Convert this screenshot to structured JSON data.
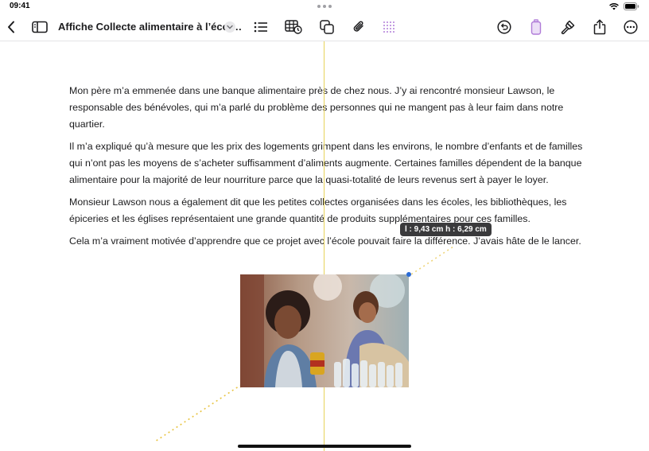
{
  "status_bar": {
    "time": "09:41"
  },
  "toolbar": {
    "title": "Affiche Collecte alimentaire à l’écol…",
    "icons": [
      "back-chevron-icon",
      "sidebar-icon",
      "title-chevron-down-icon",
      "list-icon",
      "table-icon",
      "shapes-icon",
      "attachment-icon",
      "grid-icon",
      "undo-icon",
      "pen-icon",
      "brush-icon",
      "share-icon",
      "more-icon"
    ],
    "accent_color": "#b07cd8"
  },
  "document": {
    "paragraphs": [
      "Mon père m’a emmenée dans une banque alimentaire près de chez nous. J’y ai rencontré monsieur Lawson, le responsable des bénévoles, qui m’a parlé du problème des personnes qui ne mangent pas à leur faim dans notre quartier.",
      "Il m’a expliqué qu’à mesure que les prix des logements grimpent dans les environs, le nombre d’enfants et de familles qui n’ont pas les moyens de s’acheter suffisamment d’aliments augmente. Certaines familles dépendent de la banque alimentaire pour la majorité de leur nourriture parce que la quasi-totalité de leurs revenus sert à payer le loyer.",
      "Monsieur Lawson nous a également dit que les petites collectes organisées dans les écoles, les bibliothèques, les épiceries et les églises représentaient une grande quantité de produits supplémentaires pour ces familles.",
      "Cela m’a vraiment motivée d’apprendre que ce projet avec l’école pouvait faire la différence. J’avais hâte de le lancer."
    ]
  },
  "image_overlay": {
    "dimensions_label": "l : 9,43 cm  h : 6,29 cm",
    "guide_color": "#e8d35a",
    "handle_color": "#2a6bd6"
  }
}
